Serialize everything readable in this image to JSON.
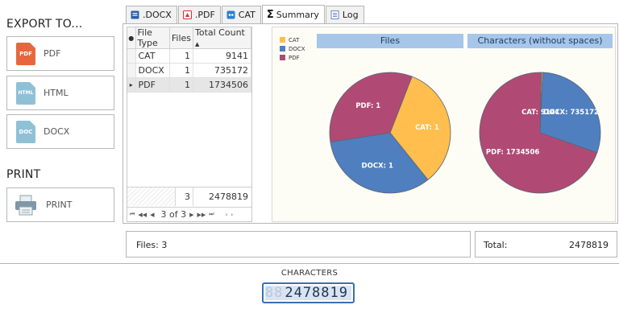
{
  "export": {
    "title": "EXPORT TO...",
    "buttons": [
      {
        "label": "PDF",
        "icon": "pdf-file-icon",
        "icon_text": "PDF",
        "color": "#e8663d"
      },
      {
        "label": "HTML",
        "icon": "html-file-icon",
        "icon_text": "HTML",
        "color": "#8fc1d6"
      },
      {
        "label": "DOCX",
        "icon": "docx-file-icon",
        "icon_text": "DOC",
        "color": "#8fc1d6"
      }
    ]
  },
  "print": {
    "title": "PRINT",
    "button_label": "PRINT",
    "icon": "printer-icon"
  },
  "tabs": [
    {
      "label": ".DOCX",
      "icon": "docx-tab-icon",
      "color": "#2b5fa8"
    },
    {
      "label": ".PDF",
      "icon": "pdf-tab-icon",
      "color": "#d9302c"
    },
    {
      "label": "CAT",
      "icon": "cat-tab-icon",
      "color": "#2e7fd0"
    },
    {
      "label": "Summary",
      "icon": "sigma-icon",
      "active": true
    },
    {
      "label": "Log",
      "icon": "log-tab-icon",
      "color": "#6b86c4"
    }
  ],
  "grid": {
    "columns": [
      "File Type",
      "Files",
      "Total Count"
    ],
    "sort_indicator": "▲",
    "rows": [
      {
        "type": "CAT",
        "files": "1",
        "total": "9141"
      },
      {
        "type": "DOCX",
        "files": "1",
        "total": "735172"
      },
      {
        "type": "PDF",
        "files": "1",
        "total": "1734506",
        "selected": true
      }
    ],
    "footer_files": "3",
    "footer_total": "2478819",
    "pager_text": "3 of 3"
  },
  "chart_data": {
    "type": "pie",
    "legend": [
      {
        "name": "CAT",
        "color": "#ffbe4d"
      },
      {
        "name": "DOCX",
        "color": "#4f7fbf"
      },
      {
        "name": "PDF",
        "color": "#b04a74"
      }
    ],
    "charts": [
      {
        "title": "Files",
        "slices": [
          {
            "name": "CAT",
            "value": 1,
            "label": "CAT: 1"
          },
          {
            "name": "DOCX",
            "value": 1,
            "label": "DOCX: 1"
          },
          {
            "name": "PDF",
            "value": 1,
            "label": "PDF: 1"
          }
        ]
      },
      {
        "title": "Characters (without spaces)",
        "slices": [
          {
            "name": "CAT",
            "value": 9141,
            "label": "CAT: 9141"
          },
          {
            "name": "DOCX",
            "value": 735172,
            "label": "DOCX: 735172"
          },
          {
            "name": "PDF",
            "value": 1734506,
            "label": "PDF: 1734506"
          }
        ]
      }
    ]
  },
  "summary": {
    "files_text": "Files: 3",
    "total_label": "Total:",
    "total_value": "2478819"
  },
  "characters": {
    "label": "CHARACTERS",
    "lcd_ghost": "88",
    "lcd_value": "2478819"
  }
}
